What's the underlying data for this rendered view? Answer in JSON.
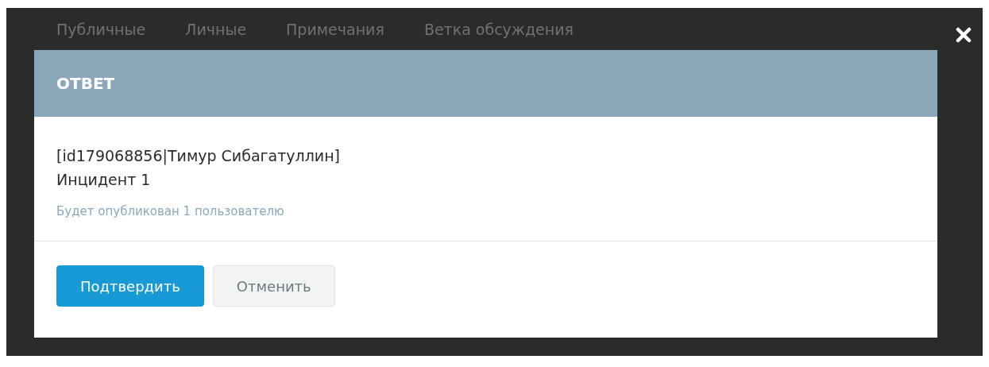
{
  "background_tabs": [
    {
      "label": "Публичные"
    },
    {
      "label": "Личные"
    },
    {
      "label": "Примечания"
    },
    {
      "label": "Ветка обсуждения"
    }
  ],
  "dialog": {
    "title": "ОТВЕТ",
    "message_lines": [
      "[id179068856|Тимур Сибагатуллин]",
      "Инцидент 1"
    ],
    "note": "Будет опубликован 1 пользователю",
    "buttons": [
      {
        "label": "Подтвердить",
        "kind": "primary"
      },
      {
        "label": "Отменить",
        "kind": "secondary"
      }
    ]
  }
}
